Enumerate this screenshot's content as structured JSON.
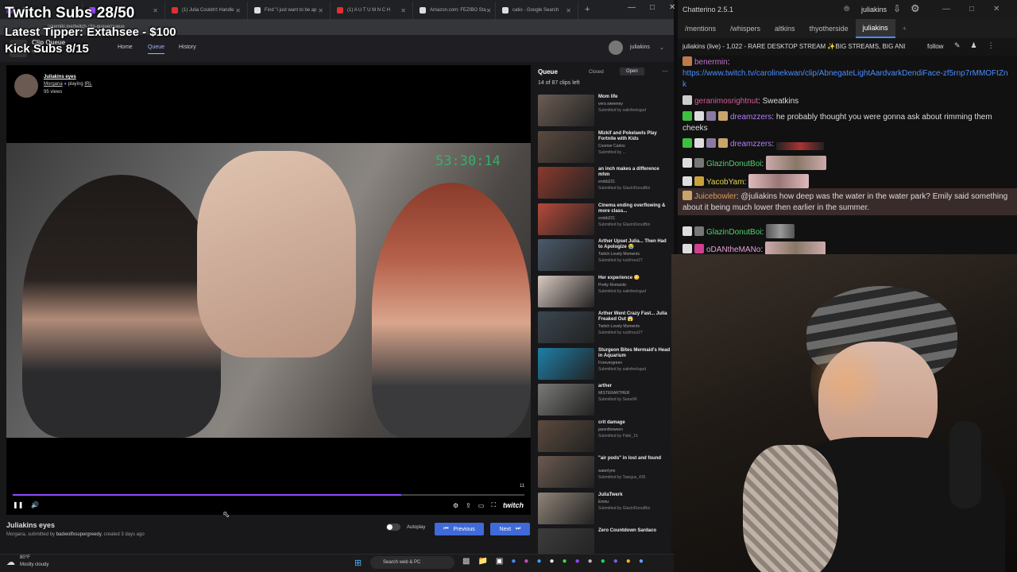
{
  "overlay": {
    "twitch_subs": "Twitch Subs 28/50",
    "latest_tipper": "Latest Tipper: Extahsee - $100",
    "kick_subs": "Kick Subs 8/15"
  },
  "browser": {
    "tabs": [
      {
        "label": "— Twit",
        "color": "#9147ff"
      },
      {
        "label": "Cli",
        "color": "#9147ff"
      },
      {
        "label": "(1) Julia Couldn't Handle",
        "color": "#e03030"
      },
      {
        "label": "Find \"i just want to be ap",
        "color": "#ddd"
      },
      {
        "label": "(1) A U T U M N  C H",
        "color": "#e03030"
      },
      {
        "label": "Amazon.com: FEZIBO Sta",
        "color": "#ddd"
      },
      {
        "label": "catio - Google Search",
        "color": "#ddd"
      }
    ],
    "url": "jakemiki.me/twitch-clip-queue/queue"
  },
  "site": {
    "title": "Clip Queue",
    "subtitle": "by jakemiki",
    "nav": {
      "home": "Home",
      "queue": "Queue",
      "history": "History"
    },
    "username": "juliakins"
  },
  "player": {
    "clip_title": "Juliakins eyes",
    "channel": "Morgana",
    "playing_word": "playing",
    "category": "IRL",
    "views": "95 views",
    "video_timestamp": "53:30:14",
    "elapsed": "11",
    "progress": 0.76,
    "logo": "twitch"
  },
  "below_player": {
    "title": "Juliakins eyes",
    "channel": "Morgana",
    "submitted_by_prefix": ", submitted by",
    "submitter": "badwolfxsupergreedy",
    "created": ", created 3 days ago",
    "autoplay_label": "Autoplay",
    "prev_label": "Previous",
    "next_label": "Next"
  },
  "queue": {
    "title": "Queue",
    "count": "14 of 87 clips left",
    "closed_label": "Closed",
    "open_label": "Open",
    "items": [
      {
        "title": "Mom life",
        "channel": "vera sweeney",
        "submitter": "Submitted by satinfeelsgud",
        "thumb": "#6b5d54"
      },
      {
        "title": "Mizkif and Pokelawls Play Fortnite with Kids",
        "channel": "Coomer Carlos",
        "submitter": "Submitted by ...",
        "thumb": "#5a4a3f"
      },
      {
        "title": "an inch makes a difference mhm",
        "channel": "erobb221",
        "submitter": "Submitted by GlazinDonutBoi",
        "thumb": "#8a3a2e"
      },
      {
        "title": "Cinema ending overflowing & more class...",
        "channel": "erobb221",
        "submitter": "Submitted by GlazinDonutBoi",
        "thumb": "#b44a3a"
      },
      {
        "title": "Arther Upset Julia... Then Had to Apologize 😭",
        "channel": "Twitch Lovely Moments",
        "submitter": "Submitted by rushhour27",
        "thumb": "#4b5a6a"
      },
      {
        "title": "Her experience 😳",
        "channel": "Pretty Romantic",
        "submitter": "Submitted by satinfeelsgud",
        "thumb": "#d8c9c0"
      },
      {
        "title": "Arther Went Crazy Fast... Julia Freaked Out 😱",
        "channel": "Twitch Lovely Moments",
        "submitter": "Submitted by rushhour27",
        "thumb": "#3b4650"
      },
      {
        "title": "Sturgeon Bites Mermaid's Head in Aquarium",
        "channel": "Forevergreen",
        "submitter": "Submitted by satinfeelsgud",
        "thumb": "#1e7fa8"
      },
      {
        "title": "arther",
        "channel": "MISTERARTHER",
        "submitter": "Submitted by Sanw96",
        "thumb": "#7a7a78"
      },
      {
        "title": "crit damage",
        "channel": "jasontheween",
        "submitter": "Submitted by Fidel_15",
        "thumb": "#5c4a3e"
      },
      {
        "title": "\"air pods\" in lost and found",
        "channel": "waterlynn",
        "submitter": "Submitted by Taargus_435",
        "thumb": "#6a5a50"
      },
      {
        "title": "JuliaTwerk",
        "channel": "Emiru",
        "submitter": "Submitted by GlazinDonutBoi",
        "thumb": "#8f8478"
      },
      {
        "title": "Zero Countdown Sardaco",
        "channel": "",
        "submitter": "",
        "thumb": "#3c3c3c"
      }
    ]
  },
  "chat": {
    "app_title": "Chatterino 2.5.1",
    "user": "juliakins",
    "tabs": [
      "/mentions",
      "/whispers",
      "altkins",
      "thyotherside",
      "juliakins"
    ],
    "channel_info": "juliakins (live) - 1,022 - RARE DESKTOP STREAM ✨BIG STREAMS, BIG ANI",
    "follow_label": "follow",
    "messages": [
      {
        "user": "benermin",
        "color": "#c86fd6",
        "text": "https://www.twitch.tv/carolinekwan/clip/AbnegateLightAardvarkDendiFace-zf5rnp7rMMOFtZnk"
      },
      {
        "user": "geranimosrightnut",
        "color": "#d65c9d",
        "text": "Sweatkins"
      },
      {
        "user": "dreamzzers",
        "color": "#b57bff",
        "text": "he probably thought you were gonna ask about rimming them cheeks"
      },
      {
        "user": "dreamzzers",
        "color": "#b57bff",
        "text": ""
      },
      {
        "user": "GlazinDonutBoi",
        "color": "#4ed16a",
        "text": ""
      },
      {
        "user": "YacobYam",
        "color": "#e8d74f",
        "text": ""
      },
      {
        "user": "Juicebowler",
        "color": "#d6a05c",
        "text": "@juliakins how deep was the water in the water park? Emily said something about it being much lower then earlier in the summer."
      },
      {
        "user": "GlazinDonutBoi",
        "color": "#4ed16a",
        "text": ""
      },
      {
        "user": "oDANtheMANo",
        "color": "#e8a0d8",
        "text": ""
      }
    ]
  },
  "taskbar": {
    "temp": "80°F",
    "weather": "Mostly cloudy",
    "search": "Search web & PC"
  },
  "icons": {
    "back": "arrow-left-icon",
    "star": "star-icon",
    "play_pause": "pause-icon",
    "volume": "volume-icon",
    "settings": "gear-icon",
    "share": "share-icon",
    "fullscreen": "fullscreen-icon"
  }
}
